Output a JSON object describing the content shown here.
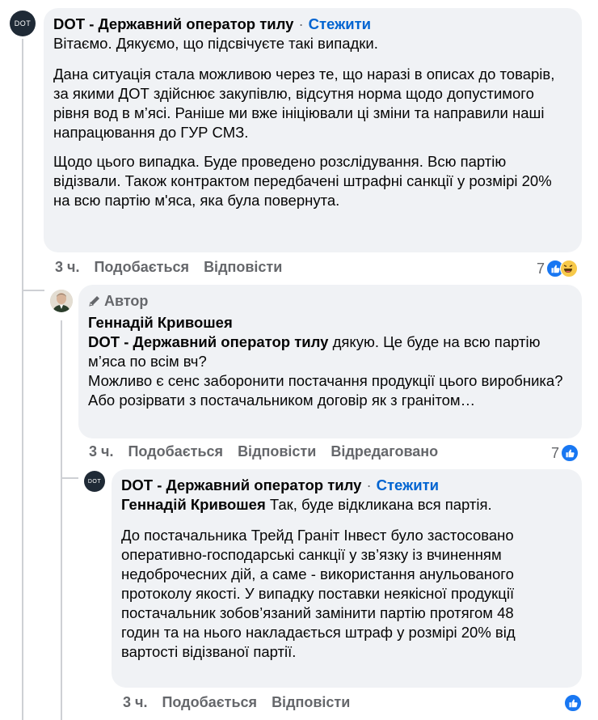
{
  "comments": [
    {
      "avatar_text": "DOT",
      "author": "DOT - Державний оператор тилу",
      "separator": "·",
      "follow_label": "Стежити",
      "paragraphs": [
        "Вітаємо. Дякуємо, що підсвічуєте такі випадки.",
        "Дана ситуація стала можливою через те, що наразі в описах до товарів, за якими ДОТ здійснює закупівлю, відсутня норма щодо допустимого рівня вод в м’ясі. Раніше ми вже ініціювали ці зміни та направили наші напрацювання до ГУР СМЗ.",
        "Щодо цього випадка. Буде проведено розслідування. Всю партію відізвали. Також контрактом передбачені штрафні санкції у розмірі 20% на всю партію м'яса, яка була повернута."
      ],
      "time": "3 ч.",
      "like_label": "Подобається",
      "reply_label": "Відповісти",
      "reaction_count": "7"
    },
    {
      "badge": "Автор",
      "author": "Геннадій Кривошея",
      "mention": "DOT - Державний оператор тилу",
      "lines": [
        "дякую. Це буде на всю партію м’яса по всім вч?",
        "Можливо є сенс заборонити постачання продукції цього виробника?",
        "Або розірвати з постачальником договір як з гранітом…"
      ],
      "time": "3 ч.",
      "like_label": "Подобається",
      "reply_label": "Відповісти",
      "edited_label": "Відредаговано",
      "reaction_count": "7"
    },
    {
      "avatar_text": "DOT",
      "author": "DOT - Державний оператор тилу",
      "separator": "·",
      "follow_label": "Стежити",
      "mention": "Геннадій Кривошея",
      "first_line": "Так, буде відкликана вся партія.",
      "paragraph": "До постачальника Трейд Граніт Інвест було застосовано оперативно-господарські санкції у зв’язку із вчиненням недоброчесних дій, а саме - використання анульованого протоколу якості. У випадку поставки неякісної продукції постачальник зобов’язаний замінити партію протягом 48 годин та на нього накладається штраф у розмірі 20% від вартості відізваної партії.",
      "time": "3 ч.",
      "like_label": "Подобається",
      "reply_label": "Відповісти"
    }
  ],
  "colors": {
    "link": "#0064d1",
    "bubble": "#f0f2f5",
    "muted": "#65676b",
    "like": "#1877f2"
  }
}
